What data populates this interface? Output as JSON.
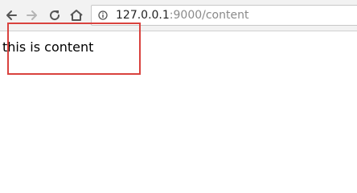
{
  "toolbar": {
    "back_icon": "arrow-left-icon",
    "forward_icon": "arrow-right-icon",
    "reload_icon": "reload-icon",
    "home_icon": "home-icon",
    "info_icon": "info-icon"
  },
  "address_bar": {
    "host": "127.0.0.1",
    "rest": ":9000/content"
  },
  "page": {
    "text": "this is content"
  },
  "annotation": {
    "box_color": "#d9423e"
  }
}
